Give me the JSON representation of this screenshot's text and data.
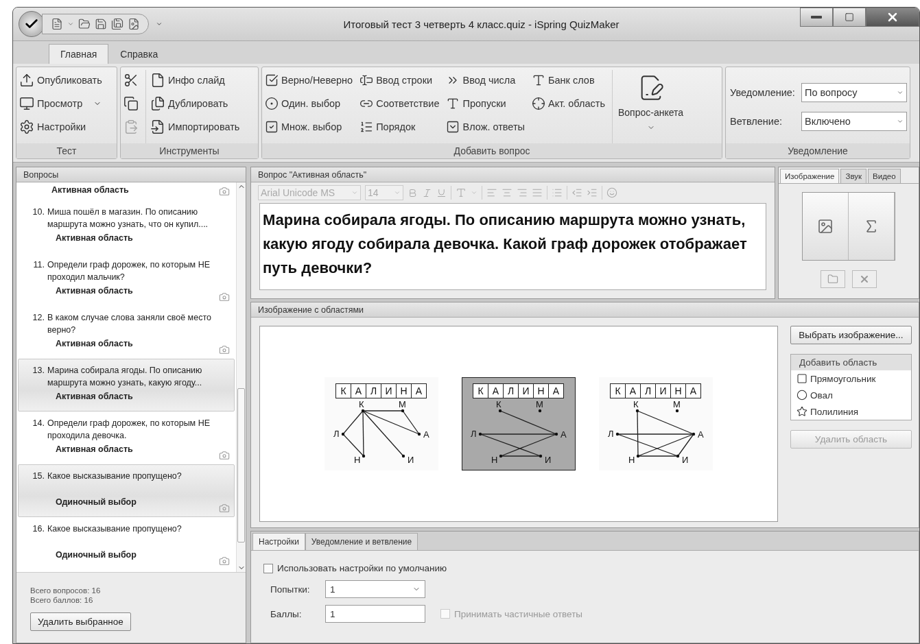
{
  "window": {
    "title": "Итоговый тест 3 четверть 4 класс.quiz - iSpring QuizMaker"
  },
  "ribbon": {
    "tabs": [
      {
        "label": "Главная",
        "selected": true
      },
      {
        "label": "Справка",
        "selected": false
      }
    ],
    "test_group": {
      "title": "Тест",
      "items": [
        {
          "label": "Опубликовать",
          "dropdown": false
        },
        {
          "label": "Просмотр",
          "dropdown": true
        },
        {
          "label": "Настройки",
          "dropdown": false
        }
      ]
    },
    "tools_group": {
      "title": "Инструменты",
      "small_tools": [
        {
          "disabled": false
        },
        {
          "disabled": false
        },
        {
          "disabled": true
        }
      ],
      "items": [
        {
          "label": "Инфо слайд"
        },
        {
          "label": "Дублировать"
        },
        {
          "label": "Импортировать"
        }
      ]
    },
    "question_group": {
      "title": "Добавить вопрос",
      "columns": [
        [
          {
            "label": "Верно/Неверно"
          },
          {
            "label": "Один. выбор"
          },
          {
            "label": "Множ. выбор"
          }
        ],
        [
          {
            "label": "Ввод строки"
          },
          {
            "label": "Соответствие"
          },
          {
            "label": "Порядок"
          }
        ],
        [
          {
            "label": "Ввод числа"
          },
          {
            "label": "Пропуски"
          },
          {
            "label": "Влож. ответы"
          }
        ],
        [
          {
            "label": "Банк слов"
          },
          {
            "label": "Акт. область"
          }
        ]
      ],
      "survey": {
        "label": "Вопрос-анкета"
      }
    },
    "notify_group": {
      "title": "Уведомление",
      "fields": [
        {
          "label": "Уведомление:",
          "value": "По вопросу"
        },
        {
          "label": "Ветвление:",
          "value": "Включено"
        }
      ]
    }
  },
  "questions": {
    "title": "Вопросы",
    "items": [
      {
        "type": "Активная область",
        "selected": false,
        "media": true
      },
      {
        "number": "10.",
        "text": "Миша пошёл в магазин. По описанию маршрута можно узнать, что он купил....",
        "type": "Активная область",
        "selected": false,
        "media": false
      },
      {
        "number": "11.",
        "text": "Определи граф дорожек, по которым НЕ проходил мальчик?",
        "type": "Активная область",
        "selected": false,
        "media": true
      },
      {
        "number": "12.",
        "text": "В каком случае слова заняли своё место верно?",
        "type": "Активная область",
        "selected": false,
        "media": true
      },
      {
        "number": "13.",
        "text": "Марина собирала ягоды. По описанию маршрута можно узнать, какую ягоду...",
        "type": "Активная область",
        "selected": true,
        "media": false
      },
      {
        "number": "14.",
        "text": "Определи граф дорожек, по которым НЕ проходила девочка.",
        "type": "Активная область",
        "selected": false,
        "media": true
      },
      {
        "number": "15.",
        "text": "Какое высказывание пропущено?",
        "type": "Одиночный выбор",
        "selected": true,
        "media": true
      },
      {
        "number": "16.",
        "text": "Какое высказывание пропущено?",
        "type": "Одиночный выбор",
        "selected": false,
        "media": true
      }
    ],
    "total_questions": "Всего вопросов: 16",
    "total_points": "Всего баллов: 16",
    "delete_button": "Удалить выбранное"
  },
  "editor": {
    "title": "Вопрос \"Активная область\"",
    "font": "Arial Unicode MS",
    "size": "14",
    "text": "Марина собирала ягоды. По описанию маршрута можно узнать, какую ягоду собирала девочка. Какой граф дорожек отображает путь девочки?"
  },
  "media": {
    "tabs": [
      {
        "label": "Изображение",
        "selected": true
      },
      {
        "label": "Звук",
        "selected": false
      },
      {
        "label": "Видео",
        "selected": false
      }
    ]
  },
  "areas": {
    "title": "Изображение с областями",
    "graphs": [
      {
        "word": [
          "К",
          "А",
          "Л",
          "И",
          "Н",
          "А"
        ],
        "nodes": [
          "К",
          "М",
          "Л",
          "А",
          "Н",
          "И"
        ],
        "selected": false
      },
      {
        "word": [
          "К",
          "А",
          "Л",
          "И",
          "Н",
          "А"
        ],
        "nodes": [
          "К",
          "М",
          "Л",
          "А",
          "Н",
          "И"
        ],
        "selected": true
      },
      {
        "word": [
          "К",
          "А",
          "Л",
          "И",
          "Н",
          "А"
        ],
        "nodes": [
          "К",
          "М",
          "Л",
          "А",
          "Н",
          "И"
        ],
        "selected": false
      }
    ],
    "choose_button": "Выбрать изображение...",
    "add_area": {
      "title": "Добавить область",
      "items": [
        {
          "kind": "rect",
          "label": "Прямоугольник"
        },
        {
          "kind": "oval",
          "label": "Овал"
        },
        {
          "kind": "star",
          "label": "Полилиния"
        }
      ]
    },
    "delete_area": {
      "label": "Удалить область",
      "disabled": true
    }
  },
  "settings": {
    "tabs": [
      {
        "label": "Настройки",
        "selected": true
      },
      {
        "label": "Уведомление и ветвление",
        "selected": false
      }
    ],
    "use_default": {
      "label": "Использовать настройки по умолчанию",
      "checked": false
    },
    "attempts": {
      "label": "Попытки:",
      "value": "1"
    },
    "points": {
      "label": "Баллы:",
      "value": "1"
    },
    "partial": {
      "label": "Принимать частичные ответы",
      "checked": false,
      "disabled": true
    }
  }
}
